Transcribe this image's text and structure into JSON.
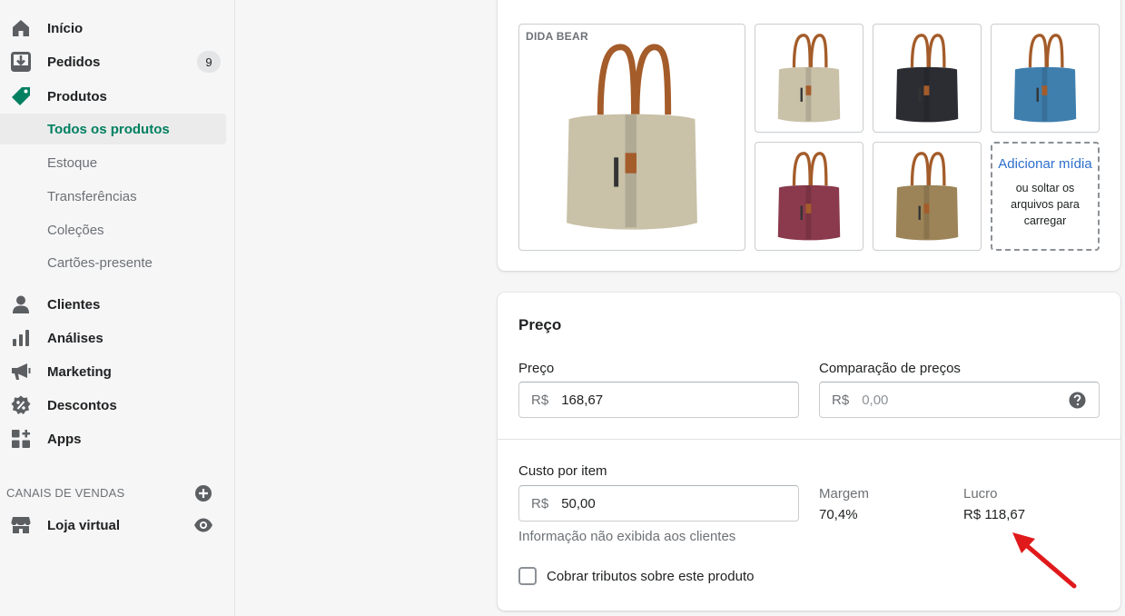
{
  "sidebar": {
    "items": [
      {
        "label": "Início",
        "icon": "home-icon"
      },
      {
        "label": "Pedidos",
        "icon": "orders-icon",
        "badge": "9"
      },
      {
        "label": "Produtos",
        "icon": "tag-icon"
      }
    ],
    "products_sub": [
      {
        "label": "Todos os produtos",
        "active": true
      },
      {
        "label": "Estoque"
      },
      {
        "label": "Transferências"
      },
      {
        "label": "Coleções"
      },
      {
        "label": "Cartões-presente"
      }
    ],
    "items2": [
      {
        "label": "Clientes",
        "icon": "person-icon"
      },
      {
        "label": "Análises",
        "icon": "bar-chart-icon"
      },
      {
        "label": "Marketing",
        "icon": "megaphone-icon"
      },
      {
        "label": "Descontos",
        "icon": "discount-icon"
      },
      {
        "label": "Apps",
        "icon": "apps-icon"
      }
    ],
    "sales_channels_title": "CANAIS DE VENDAS",
    "sales_channel": {
      "label": "Loja virtual",
      "icon": "store-icon"
    }
  },
  "media": {
    "brand": "DIDA BEAR",
    "add_media_link": "Adicionar mídia",
    "add_media_hint": "ou soltar os arquivos para carregar",
    "thumbnails": [
      {
        "name": "bag-beige",
        "color": "#c9c1a8"
      },
      {
        "name": "bag-black",
        "color": "#2b2d33"
      },
      {
        "name": "bag-blue",
        "color": "#3f7fae"
      },
      {
        "name": "bag-wine",
        "color": "#8a3a4c"
      },
      {
        "name": "bag-khaki",
        "color": "#9c8458"
      }
    ],
    "main_color": "#c9c1a8"
  },
  "pricing": {
    "title": "Preço",
    "price_label": "Preço",
    "price_prefix": "R$",
    "price_value": "168,67",
    "compare_label": "Comparação de preços",
    "compare_prefix": "R$",
    "compare_placeholder": "0,00",
    "cost_label": "Custo por item",
    "cost_prefix": "R$",
    "cost_value": "50,00",
    "margin_label": "Margem",
    "margin_value": "70,4%",
    "profit_label": "Lucro",
    "profit_value": "R$ 118,67",
    "cost_help": "Informação não exibida aos clientes",
    "tax_checkbox_label": "Cobrar tributos sobre este produto",
    "tax_checked": false
  },
  "colors": {
    "accent": "#008060",
    "link": "#2c6ecb",
    "annotation_arrow": "#e0191b"
  }
}
